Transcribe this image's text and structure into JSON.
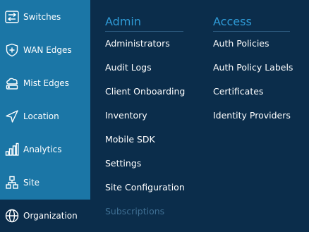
{
  "sidebar": {
    "items": [
      {
        "label": "Switches",
        "icon": "switches-icon"
      },
      {
        "label": "WAN Edges",
        "icon": "wan-edges-icon"
      },
      {
        "label": "Mist Edges",
        "icon": "mist-edges-icon"
      },
      {
        "label": "Location",
        "icon": "location-icon"
      },
      {
        "label": "Analytics",
        "icon": "analytics-icon"
      },
      {
        "label": "Site",
        "icon": "site-icon"
      },
      {
        "label": "Organization",
        "icon": "organization-icon",
        "active": true
      }
    ]
  },
  "menu": {
    "admin": {
      "heading": "Admin",
      "links": [
        "Administrators",
        "Audit Logs",
        "Client Onboarding",
        "Inventory",
        "Mobile SDK",
        "Settings",
        "Site Configuration",
        "Subscriptions"
      ]
    },
    "access": {
      "heading": "Access",
      "links": [
        "Auth Policies",
        "Auth Policy Labels",
        "Certificates",
        "Identity Providers"
      ]
    }
  },
  "colors": {
    "sidebar_bg": "#1b76a6",
    "menu_bg": "#0b2d4b",
    "heading": "#2f9bd7",
    "link": "#ffffff",
    "disabled_link": "#3f6f93"
  }
}
